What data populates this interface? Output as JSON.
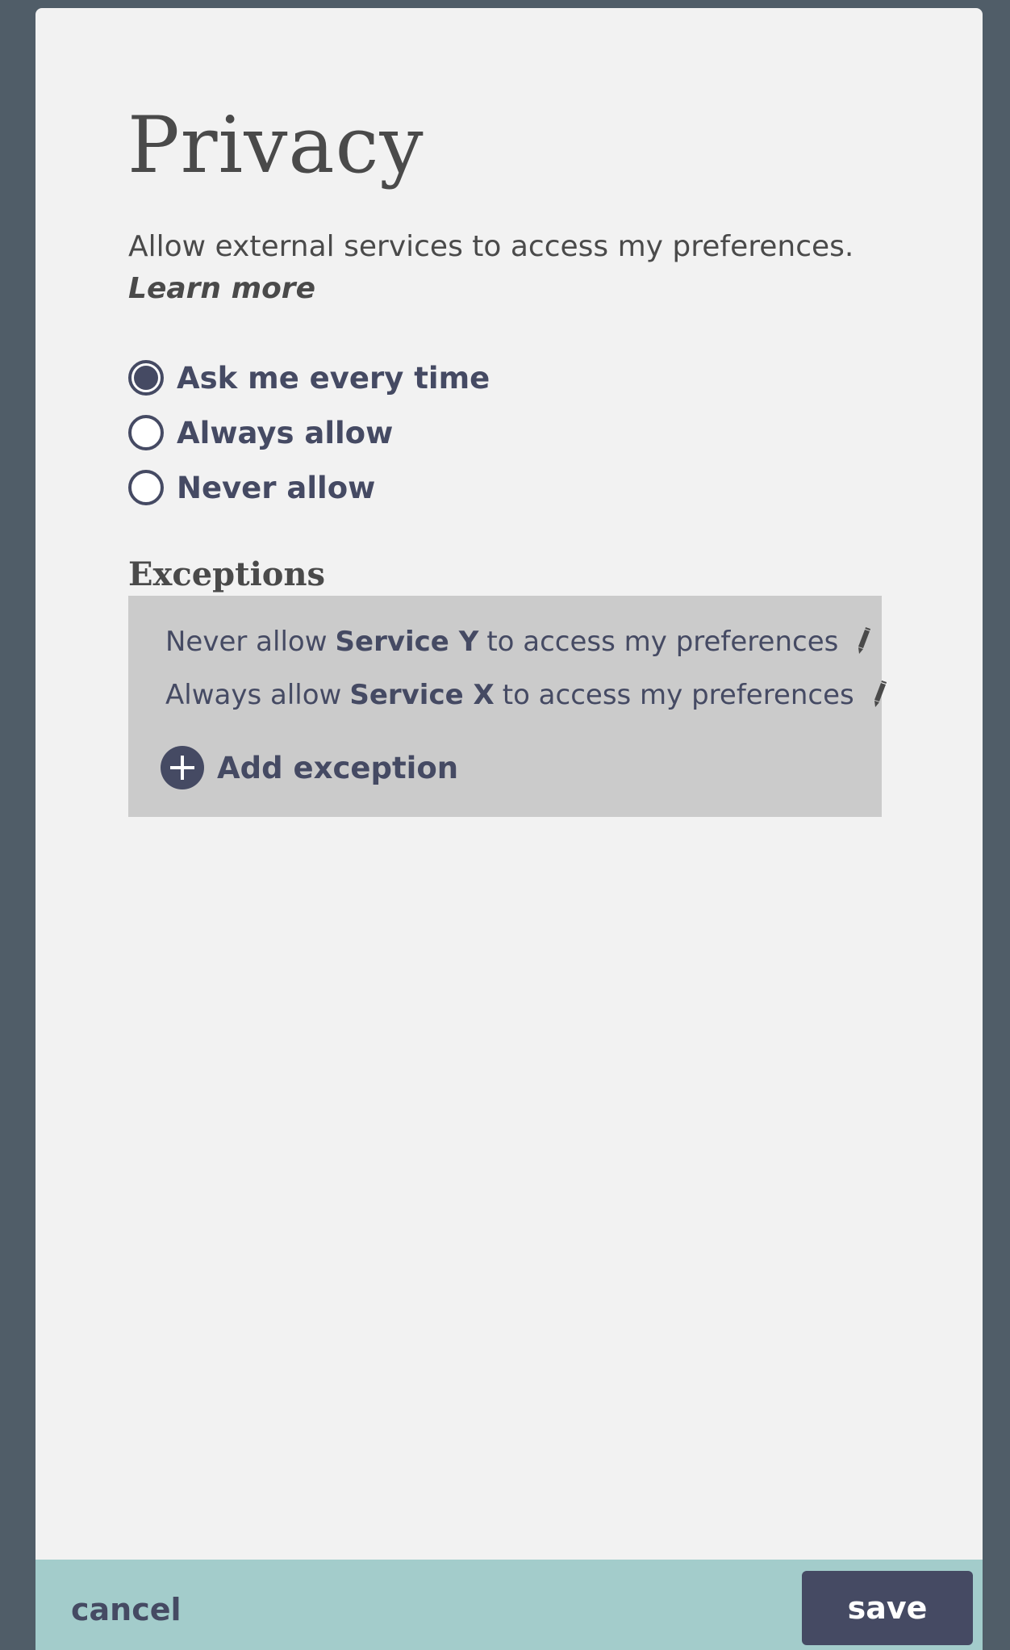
{
  "page": {
    "title": "Privacy",
    "description": "Allow external services to access my preferences.",
    "learn_more": "Learn more"
  },
  "access_options": {
    "selected": "Ask me every time",
    "items": [
      {
        "label": "Ask me every time",
        "checked": true
      },
      {
        "label": "Always allow",
        "checked": false
      },
      {
        "label": "Never allow",
        "checked": false
      }
    ]
  },
  "exceptions": {
    "heading": "Exceptions",
    "items": [
      {
        "prefix": "Never allow",
        "service": "Service Y",
        "suffix": "to access my preferences",
        "edit_icon": "pencil-icon"
      },
      {
        "prefix": "Always allow",
        "service": "Service X",
        "suffix": "to access my preferences",
        "edit_icon": "pencil-icon"
      }
    ],
    "add_label": "Add exception",
    "add_icon": "plus-circle-icon"
  },
  "footer": {
    "cancel_label": "cancel",
    "save_label": "save"
  },
  "colors": {
    "background": "#505d68",
    "panel": "#f2f2f2",
    "accent": "#454a63",
    "exceptions_box": "#cbcbcb",
    "footer": "#a3cccb"
  }
}
